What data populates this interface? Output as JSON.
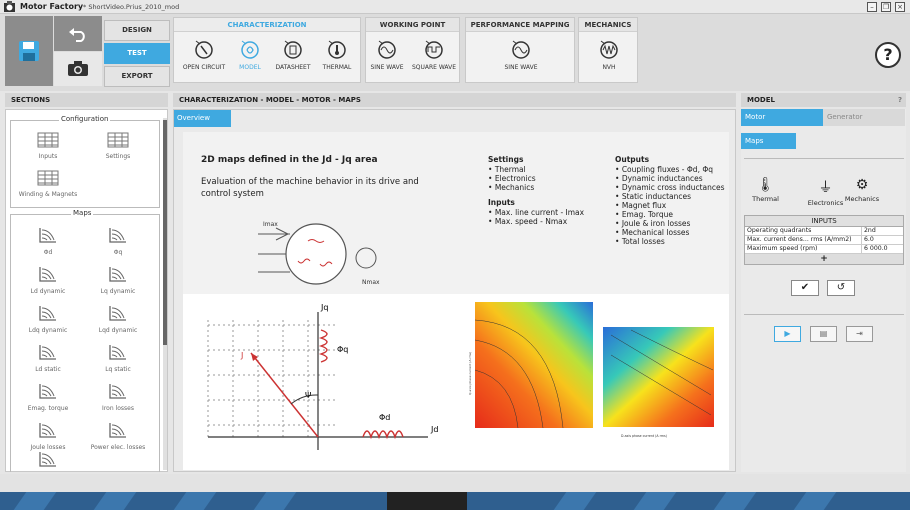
{
  "window": {
    "app_name": "Motor Factory",
    "file_name": "* ShortVideo.Prius_2010_mod"
  },
  "modes": {
    "design": "DESIGN",
    "test": "TEST",
    "export": "EXPORT"
  },
  "groups": {
    "characterization": {
      "title": "CHARACTERIZATION",
      "tools": [
        "OPEN CIRCUIT",
        "MODEL",
        "DATASHEET",
        "THERMAL"
      ]
    },
    "working_point": {
      "title": "WORKING POINT",
      "tools": [
        "SINE WAVE",
        "SQUARE WAVE"
      ]
    },
    "performance": {
      "title": "PERFORMANCE MAPPING",
      "tools": [
        "SINE WAVE"
      ]
    },
    "mechanics": {
      "title": "MECHANICS",
      "tools": [
        "NVH"
      ]
    }
  },
  "help_label": "?",
  "sections": {
    "title": "SECTIONS",
    "configuration_label": "Configuration",
    "configuration": [
      "Inputs",
      "Settings",
      "Winding & Magnets"
    ],
    "maps_label": "Maps",
    "maps": [
      "Φd",
      "Φq",
      "Ld dynamic",
      "Lq dynamic",
      "Ldq dynamic",
      "Lqd dynamic",
      "Ld static",
      "Lq static",
      "Emag. torque",
      "Iron losses",
      "Joule losses",
      "Power elec. losses"
    ]
  },
  "center": {
    "breadcrumb": "CHARACTERIZATION - MODEL - MOTOR - MAPS",
    "tab": "Overview",
    "title": "2D maps defined in the Jd - Jq area",
    "description": "Evaluation of the machine behavior in its drive and control system",
    "settings_title": "Settings",
    "settings": [
      "Thermal",
      "Electronics",
      "Mechanics"
    ],
    "inputs_title": "Inputs",
    "inputs": [
      "Max. line current - Imax",
      "Max. speed - Nmax"
    ],
    "outputs_title": "Outputs",
    "outputs": [
      "Coupling fluxes - Φd, Φq",
      "Dynamic inductances",
      "Dynamic cross inductances",
      "Static inductances",
      "Magnet flux",
      "Emag. Torque",
      "Joule & iron losses",
      "Mechanical losses",
      "Total losses"
    ],
    "diagram_labels": {
      "imax": "Imax",
      "nmax": "Nmax",
      "jq": "Jq",
      "jd": "Jd",
      "j": "J",
      "phiq": "Φq",
      "phid": "Φd",
      "psi": "Ψ"
    },
    "heatmap_labels": {
      "y_axis": "Q-axis phase current (A rms)",
      "x_axis": "D-axis phase current (A rms)"
    }
  },
  "model": {
    "title": "MODEL",
    "help": "?",
    "tabs": [
      "Motor",
      "Generator"
    ],
    "subtab": "Maps",
    "icons": [
      "Thermal",
      "Electronics",
      "Mechanics"
    ],
    "inputs_title": "INPUTS",
    "rows": [
      {
        "label": "Operating quadrants",
        "value": "2nd"
      },
      {
        "label": "Max. current dens... rms (A/mm2)",
        "value": "6.0"
      },
      {
        "label": "Maximum speed (rpm)",
        "value": "6 000.0"
      }
    ],
    "add_label": "+"
  },
  "colors": {
    "accent": "#3fa9e0",
    "header": "#d5d5d5"
  }
}
